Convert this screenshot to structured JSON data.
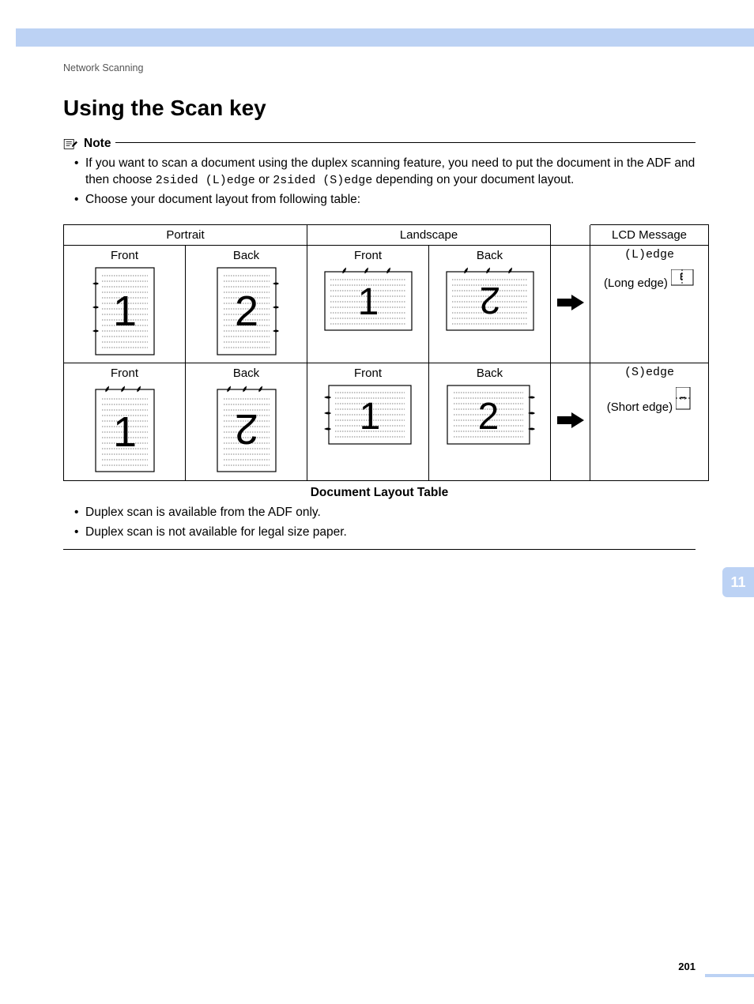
{
  "running_head": "Network Scanning",
  "title": "Using the Scan key",
  "note_label": "Note",
  "bullets_top": {
    "b1_pre": "If you want to scan a document using the duplex scanning feature, you need to put the document in the ADF and then choose ",
    "b1_code1": "2sided (L)edge",
    "b1_mid": " or ",
    "b1_code2": "2sided (S)edge",
    "b1_post": " depending on your document layout.",
    "b2": "Choose your document layout from following table:"
  },
  "table": {
    "headers": {
      "portrait": "Portrait",
      "landscape": "Landscape",
      "lcd": "LCD Message"
    },
    "labels": {
      "front": "Front",
      "back": "Back"
    },
    "row1": {
      "lcd_code": "(L)edge",
      "lcd_text": "(Long edge)"
    },
    "row2": {
      "lcd_code": "(S)edge",
      "lcd_text": "(Short edge)"
    },
    "caption": "Document Layout Table"
  },
  "bullets_bottom": {
    "b3": "Duplex scan is available from the ADF only.",
    "b4": "Duplex scan is not available for legal size paper."
  },
  "section_number": "11",
  "page_number": "201"
}
